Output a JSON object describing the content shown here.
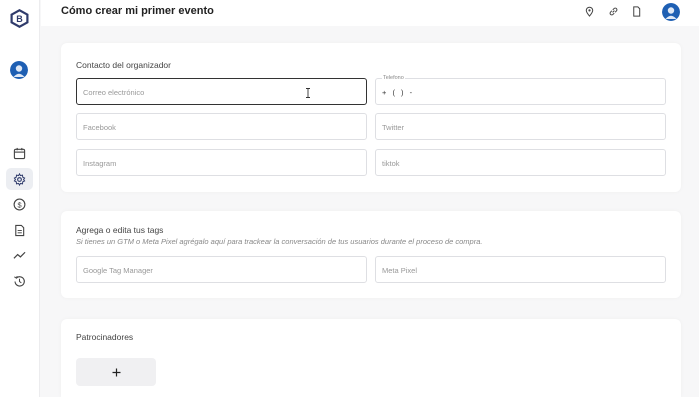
{
  "app": {
    "logo_letter": "B"
  },
  "header": {
    "title": "Cómo crear mi primer evento"
  },
  "sidebar": {
    "items": [
      {
        "icon": "calendar-icon"
      },
      {
        "icon": "gear-icon",
        "active": true
      },
      {
        "icon": "dollar-icon"
      },
      {
        "icon": "report-icon"
      },
      {
        "icon": "trend-icon"
      },
      {
        "icon": "history-icon"
      }
    ]
  },
  "organizer": {
    "title": "Contacto del organizador",
    "email_placeholder": "Correo electrónico",
    "phone_label": "Telefono",
    "phone_value": "+ ( ) -",
    "facebook_placeholder": "Facebook",
    "twitter_placeholder": "Twitter",
    "instagram_placeholder": "Instagram",
    "tiktok_placeholder": "tiktok"
  },
  "tags": {
    "title": "Agrega o edita tus tags",
    "subtitle": "Si tienes un GTM o Meta Pixel agrégalo aquí para trackear la conversación de tus usuarios durante el proceso de compra.",
    "gtm_placeholder": "Google Tag Manager",
    "pixel_placeholder": "Meta Pixel"
  },
  "sponsors": {
    "title": "Patrocinadores",
    "add_symbol": "+"
  },
  "colors": {
    "brand": "#2f3b6b",
    "active_bg": "#eceef2"
  }
}
